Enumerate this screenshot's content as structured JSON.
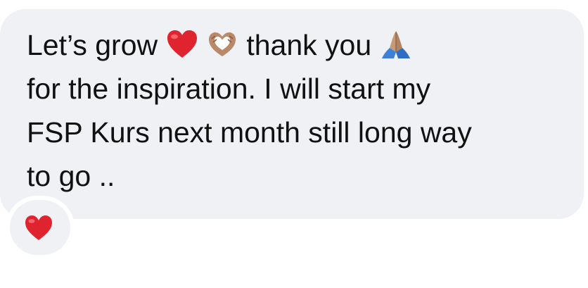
{
  "message": {
    "segments": {
      "s1": "Let’s grow ",
      "s2": " thank you ",
      "line2": "for the inspiration. I will start my",
      "line3": "FSP Kurs next month still long way",
      "line4": "to go .."
    },
    "emojis": [
      "red-heart",
      "heart-hands",
      "folded-hands"
    ]
  },
  "reaction": {
    "emoji": "red-heart"
  },
  "colors": {
    "bubble": "#f0f1f4",
    "text": "#111111",
    "heart": "#e0242f"
  }
}
